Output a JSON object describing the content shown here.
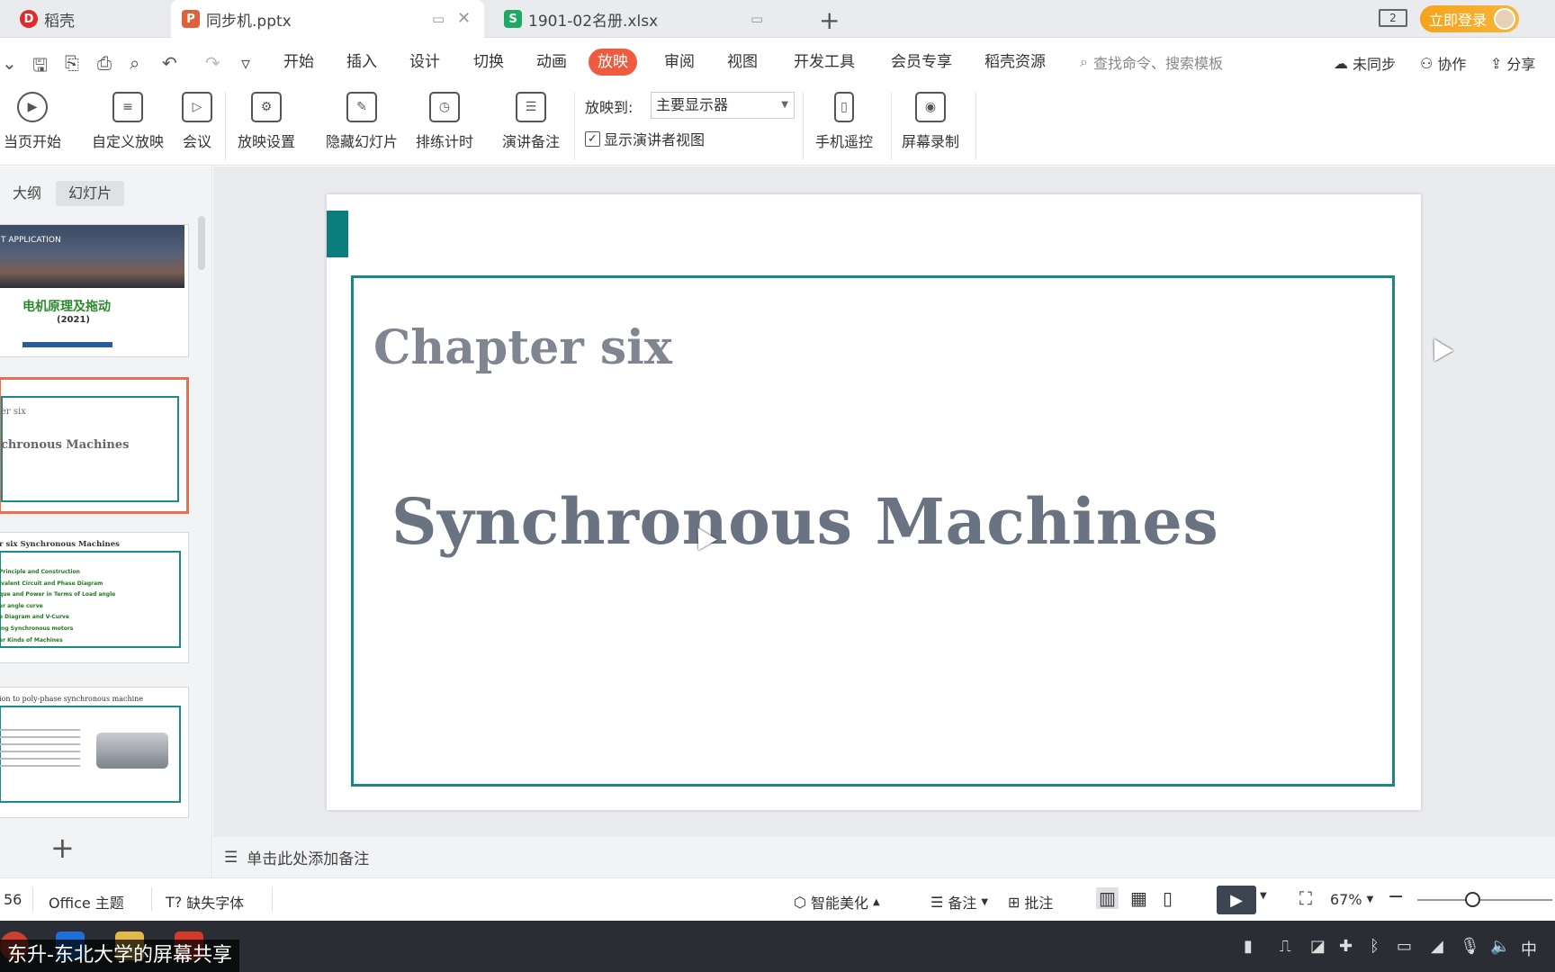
{
  "tabs": {
    "home": "稻壳",
    "pptx": "同步机.pptx",
    "xlsx": "1901-02名册.xlsx",
    "login": "立即登录"
  },
  "menu": {
    "items": [
      "开始",
      "插入",
      "设计",
      "切换",
      "动画",
      "放映",
      "审阅",
      "视图",
      "开发工具",
      "会员专享",
      "稻壳资源"
    ],
    "active": "放映",
    "search_placeholder": "查找命令、搜索模板",
    "sync": "未同步",
    "collab": "协作",
    "share": "分享"
  },
  "ribbon": {
    "from_current": "当页开始",
    "custom_show": "自定义放映",
    "meeting": "会议",
    "show_settings": "放映设置",
    "hide_slide": "隐藏幻灯片",
    "rehearse": "排练计时",
    "speaker_notes": "演讲备注",
    "show_to_label": "放映到:",
    "show_to_value": "主要显示器",
    "presenter_view": "显示演讲者视图",
    "phone_remote": "手机遥控",
    "screen_record": "屏幕录制"
  },
  "left_panel": {
    "tab_outline": "大纲",
    "tab_slides": "幻灯片",
    "thumb1": {
      "banner": "T APPLICATION",
      "title": "电机原理及拖动",
      "year": "(2021)"
    },
    "thumb2": {
      "line1": "er six",
      "line2": "chronous Machines"
    },
    "thumb3": {
      "title": "r six Synchronous Machines",
      "items": [
        "Principle and Construction",
        "ivalent Circuit and Phase Diagram",
        "que and Power in Terms of Load angle",
        "er angle curve",
        "e Diagram and V-Curve",
        "ing Synchronous motors",
        "er Kinds of Machines"
      ]
    },
    "thumb4": {
      "title": "ion to poly-phase synchronous machine"
    }
  },
  "slide": {
    "chapter": "Chapter six",
    "title": "Synchronous Machines"
  },
  "notes_placeholder": "单击此处添加备注",
  "status": {
    "slide_num": "56",
    "theme": "Office 主题",
    "missing_font": "缺失字体",
    "beautify": "智能美化",
    "notes": "备注",
    "comments": "批注",
    "zoom": "67%"
  },
  "caption": "东升-东北大学的屏幕共享",
  "colors": {
    "accent": "#ef5b3e",
    "slide_teal": "#1c8585",
    "login": "#f7a21b"
  }
}
